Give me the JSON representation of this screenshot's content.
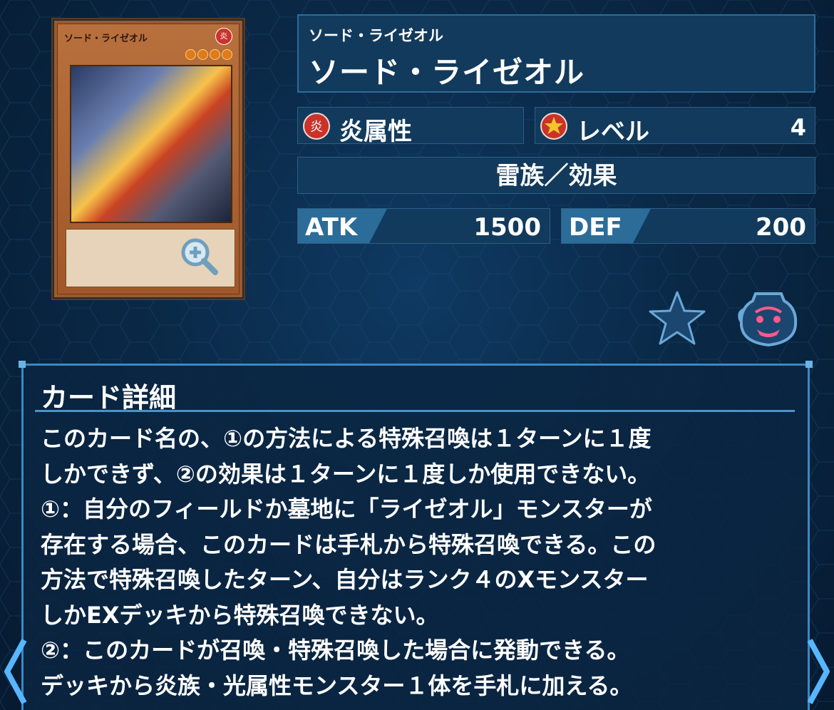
{
  "card": {
    "name_ruby": "ソード・ライゼオル",
    "name": "ソード・ライゼオル",
    "image_name": "ソード・ライゼオル",
    "attribute_icon_char": "炎",
    "level_star_count": 4
  },
  "attribute": {
    "label": "炎属性",
    "icon": "fire-attribute-icon",
    "icon_char": "炎"
  },
  "level": {
    "label": "レベル",
    "value": "4",
    "icon": "level-star-icon"
  },
  "type_line": "雷族／効果",
  "atk": {
    "label": "ATK",
    "value": "1500"
  },
  "def": {
    "label": "DEF",
    "value": "200"
  },
  "actions": {
    "favorite_icon": "star-icon",
    "pot_icon": "pot-of-greed-icon",
    "zoom_icon": "zoom-in-icon"
  },
  "detail": {
    "heading": "カード詳細",
    "lines": [
      "このカード名の、①の方法による特殊召喚は１ターンに１度",
      "しかできず、②の効果は１ターンに１度しか使用できない。",
      "①：自分のフィールドか墓地に「ライゼオル」モンスターが",
      "存在する場合、このカードは手札から特殊召喚できる。この",
      "方法で特殊召喚したターン、自分はランク４のXモンスター",
      "しかEXデッキから特殊召喚できない。",
      "②：このカードが召喚・特殊召喚した場合に発動できる。",
      "デッキから炎族・光属性モンスター１体を手札に加える。"
    ]
  },
  "colors": {
    "panel": "#123a5c",
    "border": "#2c6c99",
    "accent": "#3c88c3",
    "attr_red": "#c9332a"
  }
}
